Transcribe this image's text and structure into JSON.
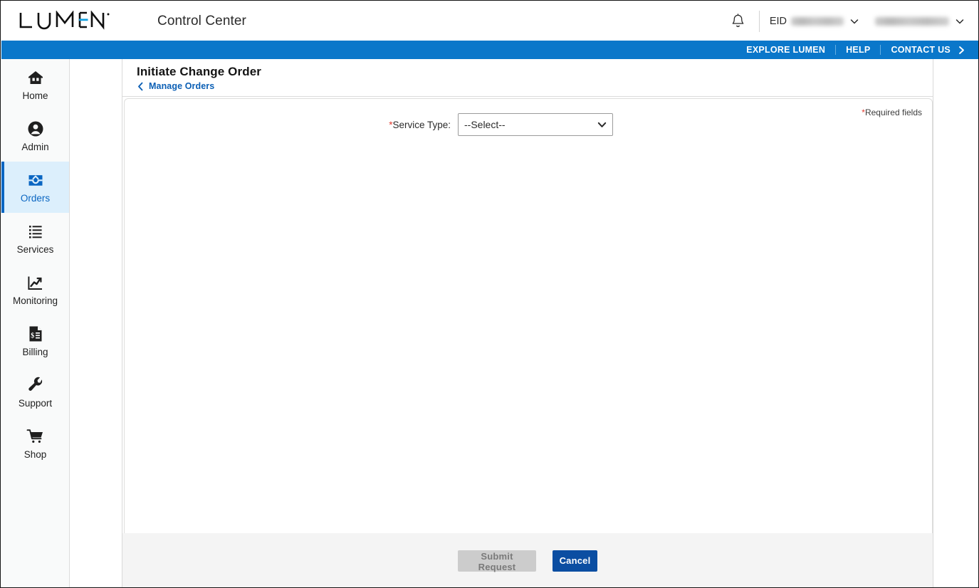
{
  "header": {
    "logo_text": "LUMEN",
    "logo_trademark": "®",
    "app_title": "Control Center",
    "bell_icon": "notification-bell-icon",
    "eid_label": "EID",
    "eid_value_masked": "",
    "account_value_masked": ""
  },
  "utility_nav": {
    "items": [
      {
        "label": "EXPLORE LUMEN"
      },
      {
        "label": "HELP"
      },
      {
        "label": "CONTACT US"
      }
    ],
    "contact_arrow_icon": "chevron-right-icon"
  },
  "sidebar": {
    "items": [
      {
        "label": "Home",
        "icon": "home-icon",
        "active": false
      },
      {
        "label": "Admin",
        "icon": "user-circle-icon",
        "active": false
      },
      {
        "label": "Orders",
        "icon": "inbox-tray-icon",
        "active": true
      },
      {
        "label": "Services",
        "icon": "list-icon",
        "active": false
      },
      {
        "label": "Monitoring",
        "icon": "chart-trend-icon",
        "active": false
      },
      {
        "label": "Billing",
        "icon": "invoice-icon",
        "active": false
      },
      {
        "label": "Support",
        "icon": "wrench-icon",
        "active": false
      },
      {
        "label": "Shop",
        "icon": "shopping-cart-icon",
        "active": false
      }
    ]
  },
  "page": {
    "title": "Initiate Change Order",
    "back_link": "Manage Orders",
    "back_icon": "chevron-left-icon"
  },
  "form": {
    "required_asterisk": "*",
    "service_type_label": "Service Type:",
    "service_type_value": "--Select--",
    "service_type_options": [
      "--Select--"
    ],
    "required_note": "Required fields",
    "dropdown_icon": "chevron-down-icon"
  },
  "footer": {
    "submit_label": "Submit Request",
    "cancel_label": "Cancel"
  },
  "colors": {
    "brand_blue": "#0a77ca",
    "active_blue": "#0a66c2",
    "active_bg": "#dceffc",
    "link_blue": "#0b5fb5",
    "cancel_blue": "#0b4ea2",
    "required_red": "#e03c31",
    "disabled_gray": "#cccccc",
    "footer_gray": "#f4f4f4"
  }
}
